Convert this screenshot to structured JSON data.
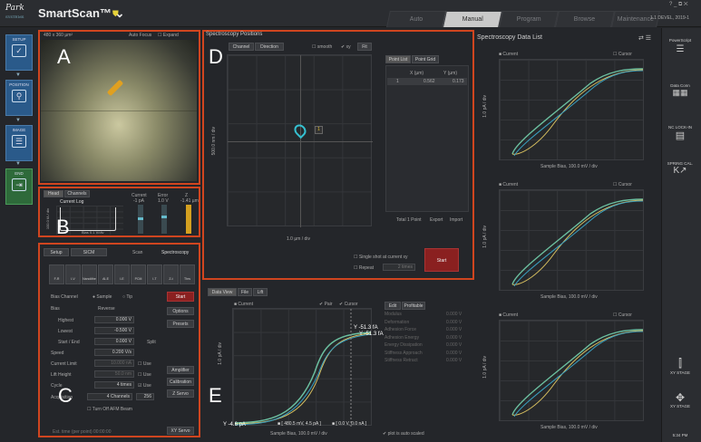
{
  "app": {
    "logo_main": "Park",
    "logo_sub": "SYSTEMS",
    "title": "SmartScan™ ⌄",
    "version": "1.1 DEVEL, 2019-1"
  },
  "tabs": [
    "Auto",
    "Manual",
    "Program",
    "Browse",
    "Maintenance"
  ],
  "nav": [
    {
      "label": "SETUP",
      "icon": "check-icon"
    },
    {
      "label": "POSITION",
      "icon": "pin-icon"
    },
    {
      "label": "IMAGE",
      "icon": "image-list-icon"
    },
    {
      "label": "END",
      "icon": "exit-icon"
    }
  ],
  "panelA": {
    "size": "480 x 360 µm²",
    "auto_focus": "Auto Focus",
    "expand": "☐ Expand",
    "letter": "A"
  },
  "panelB": {
    "tabs": [
      "Head",
      "Channels"
    ],
    "log_label": "Current Log",
    "y_axis": "100.0 fA / div",
    "x_axis": "Bias 0.1 V/div",
    "meters": [
      {
        "name": "Current",
        "value": "-1 pA"
      },
      {
        "name": "Error",
        "value": "1.0 V"
      },
      {
        "name": "Z",
        "value": "-1.41 µm"
      }
    ],
    "letter": "B"
  },
  "panelC": {
    "tabs": [
      "Setup",
      "SICM"
    ],
    "scan": "Scan",
    "spectroscopy": "Spectroscopy",
    "modes": [
      "F-R",
      "I-V",
      "Nanolithe Indent",
      "AI-E",
      "I-E",
      "PCM",
      "I-T",
      "Z-t",
      "Thrs"
    ],
    "start": "Start",
    "options": "Options",
    "presets": "Presets",
    "bias_channel": "Bias Channel",
    "sample": "Sample",
    "tip": "Tip",
    "bias": "Bias",
    "reverse": "Reverse",
    "highest": "Highest",
    "highest_v": "0.000 V",
    "lowest": "Lowest",
    "lowest_v": "-0.500 V",
    "startend": "Start / End",
    "startend_v": "0.000 V",
    "split": "Split",
    "speed": "Speed",
    "speed_v": "0.200 V/s",
    "current_limit": "Current Limit",
    "current_limit_v": "10.000 nA",
    "lift_height": "Lift Height",
    "lift_height_v": "50.0 nm",
    "use": "Use",
    "cycle": "Cycle",
    "cycle_v": "4 times",
    "acquisition": "Acquisition",
    "acq_v": "4 Channels",
    "acq_n": "256",
    "turn_off": "Turn Off AFM Beam",
    "est": "Est. time (per point) 00:00:00",
    "amplifier": "Amplifier",
    "calibration": "Calibration",
    "zservo": "Z Servo",
    "xyservo": "XY Servo",
    "letter": "C"
  },
  "panelD": {
    "title": "Spectroscopy Positions",
    "channel": "Channel",
    "direction": "Direction",
    "smooth": "smooth",
    "xy": "xy",
    "fit": "Fit",
    "y_axis": "500.0 nm / div",
    "x_axis": "1.0 µm / div",
    "tabs": [
      "Point List",
      "Point Grid"
    ],
    "cols": [
      "X (µm)",
      "Y (µm)"
    ],
    "row": [
      "1",
      "0.562",
      "0.173"
    ],
    "total": "Total 1 Point",
    "export": "Export",
    "import": "Import",
    "single": "Single shot at current xy",
    "repeat": "Repeat",
    "repeat_v": "2 times",
    "start": "Start",
    "letter": "D",
    "pin": "1"
  },
  "panelE": {
    "tabs": [
      "Data View",
      "File",
      "Lift"
    ],
    "channel": "Current",
    "pair": "Pair",
    "cursor": "Cursor",
    "y_axis": "1.0 pA / div",
    "x_axis": "Sample Bias, 100.0 mV / div",
    "ytop": "Y -51.3 fA",
    "ytop2": "Y -51.3 fA",
    "ybot": "Y -4.6 pA",
    "cur1": "480.5 mV, 4.5 pA",
    "cur2": "0.0 V, 0.0 nA",
    "plot_auto": "plot is auto scaled",
    "result_tabs": [
      "Edit",
      "Profitable"
    ],
    "results": [
      [
        "Modulus",
        "0.000 V"
      ],
      [
        "Deformation",
        "0.000 V"
      ],
      [
        "Adhesion Force",
        "0.000 V"
      ],
      [
        "Adhesion Energy",
        "0.000 V"
      ],
      [
        "Energy Dissipation",
        "0.000 V"
      ],
      [
        "Stiffness Approach",
        "0.000 V"
      ],
      [
        "Stiffness Retract",
        "0.000 V"
      ]
    ],
    "letter": "E"
  },
  "datalist": {
    "title": "Spectroscopy Data List",
    "channel": "Current",
    "cursor": "Cursor",
    "y_axis": "1.0 pA / div",
    "x_axis": "Sample Bias,  100.0 mV / div"
  },
  "rtools": [
    "PowerScript",
    "Data Conn",
    "NC LOCK-IN",
    "SPRING CAL.",
    "XY STAGE",
    "XY STAGE"
  ],
  "clock": "5:34 PM"
}
